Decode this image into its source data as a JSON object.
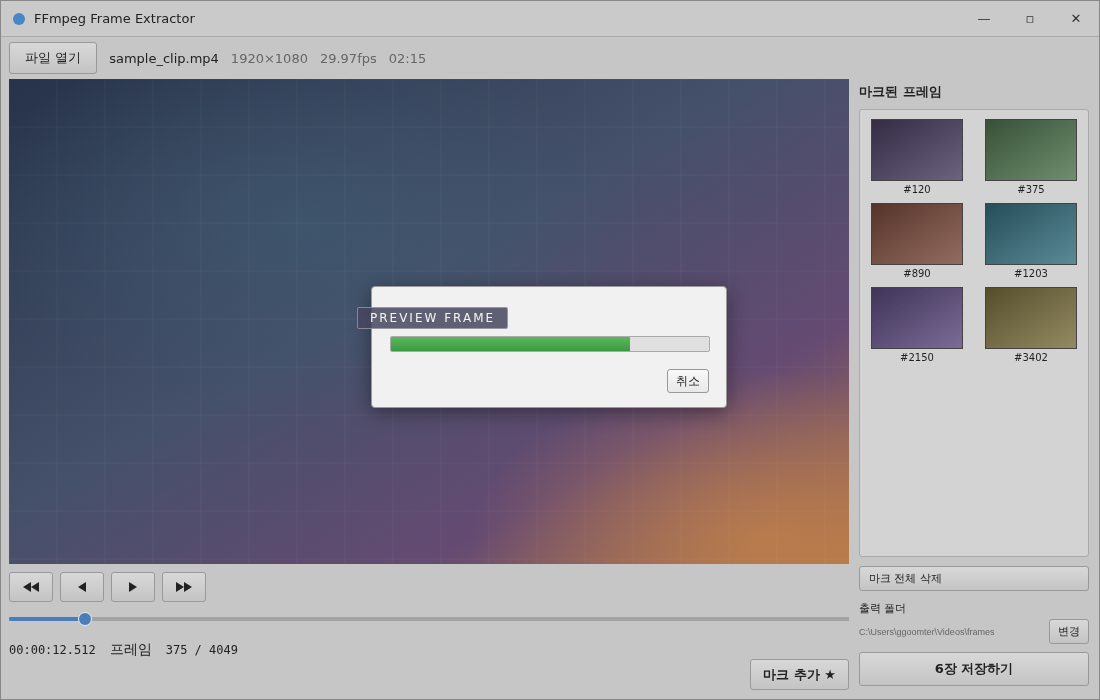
{
  "window": {
    "title": "FFmpeg Frame Extractor",
    "controls": [
      "—",
      "▫",
      "✕"
    ]
  },
  "toolbar": {
    "open_button": "파일 열기",
    "file_name": "sample_clip.mp4",
    "meta": [
      "1920×1080",
      "29.97fps",
      "02:15"
    ]
  },
  "preview": {
    "kind": "picture",
    "overlay_label": "PREVIEW FRAME"
  },
  "dialog": {
    "level": 0.75,
    "cancel": "취소"
  },
  "transport": [
    {
      "kind": "rewind"
    },
    {
      "kind": "back"
    },
    {
      "kind": "play"
    },
    {
      "kind": "forward"
    }
  ],
  "seek": {
    "level": 0.09
  },
  "timecode": "00:00:12.512",
  "frame_label": "프레임",
  "frame_count": "375 / 4049",
  "mark_button": "마크 추가 ★",
  "marked": {
    "title": "마크된 프레임",
    "frames": [
      {
        "label": "#120",
        "color": "#4a3f62"
      },
      {
        "label": "#375",
        "color": "#4f744f"
      },
      {
        "label": "#890",
        "color": "#7a4a3c"
      },
      {
        "label": "#1203",
        "color": "#35707e"
      },
      {
        "label": "#2150",
        "color": "#5c4a7e"
      },
      {
        "label": "#3402",
        "color": "#7a703e"
      }
    ]
  },
  "clear_button": "마크 전체 삭제",
  "output": {
    "label": "출력 폴더",
    "path": "C:\\Users\\ggoomter\\Videos\\frames",
    "change": "변경"
  },
  "save_button": "6장 저장하기"
}
